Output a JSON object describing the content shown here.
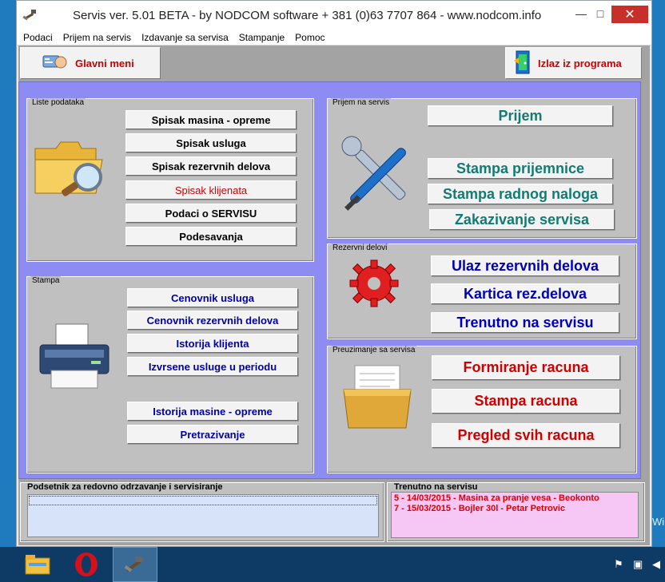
{
  "window": {
    "title": "Servis ver. 5.01 BETA - by NODCOM software  + 381 (0)63 7707 864 - www.nodcom.info",
    "minimize": "—",
    "maximize": "□",
    "close": "✕"
  },
  "menu": [
    "Podaci",
    "Prijem na servis",
    "Izdavanje sa servisa",
    "Stampanje",
    "Pomoc"
  ],
  "toolbar": {
    "main_menu": "Glavni meni",
    "exit": "Izlaz iz programa"
  },
  "liste": {
    "title": "Liste podataka",
    "buttons": [
      "Spisak masina - opreme",
      "Spisak usluga",
      "Spisak rezervnih delova",
      "Spisak klijenata",
      "Podaci o SERVISU",
      "Podesavanja"
    ]
  },
  "stampa": {
    "title": "Stampa",
    "buttons": [
      "Cenovnik usluga",
      "Cenovnik rezervnih delova",
      "Istorija klijenta",
      "Izvrsene usluge u periodu",
      "Istorija masine - opreme",
      "Pretrazivanje"
    ]
  },
  "prijem": {
    "title": "Prijem na servis",
    "buttons": [
      "Prijem",
      "Stampa prijemnice",
      "Stampa radnog naloga",
      "Zakazivanje servisa"
    ]
  },
  "rezervni": {
    "title": "Rezervni delovi",
    "buttons": [
      "Ulaz rezervnih delova",
      "Kartica rez.delova",
      "Trenutno na servisu"
    ]
  },
  "preuzimanje": {
    "title": "Preuzimanje sa servisa",
    "buttons": [
      "Formiranje racuna",
      "Stampa racuna",
      "Pregled svih racuna"
    ]
  },
  "podsetnik": {
    "title": "Podsetnik za redovno odrzavanje i servisiranje"
  },
  "trenutno": {
    "title": "Trenutno na servisu",
    "items": [
      "5 - 14/03/2015 - Masina za pranje vesa - Beokonto",
      "7 - 15/03/2015 - Bojler 30l - Petar Petrovic"
    ]
  },
  "desktop": {
    "watermark": "Wi"
  },
  "colors": {
    "accent_red": "#d00000",
    "teal": "#127b72",
    "blue": "#0000b8",
    "panel_bg": "#8c8cf2"
  },
  "icons": [
    "hammer-icon",
    "folder-search-icon",
    "printer-icon",
    "tools-icon",
    "gear-icon",
    "file-folder-icon",
    "exit-door-icon",
    "main-menu-icon"
  ]
}
